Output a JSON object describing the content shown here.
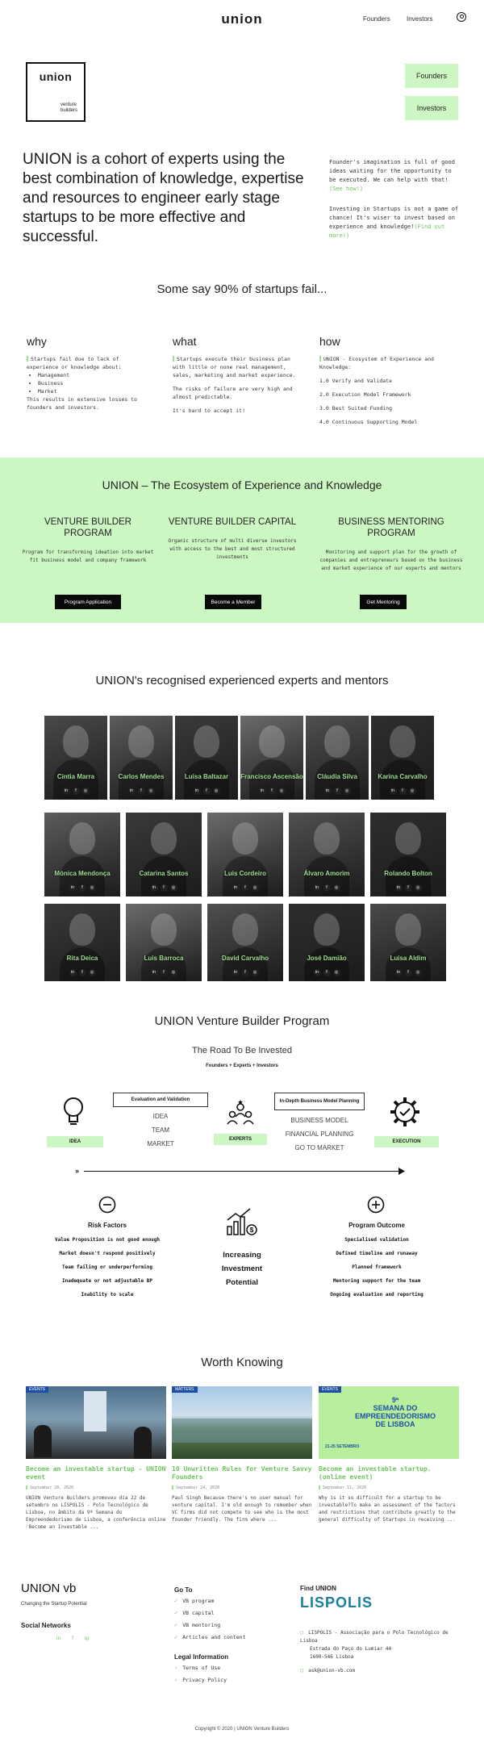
{
  "header": {
    "logo": "union",
    "nav": [
      "Founders",
      "Investors"
    ]
  },
  "brand": {
    "title": "union",
    "subtitle_line1": "venture",
    "subtitle_line2": "builders"
  },
  "side_buttons": [
    "Founders",
    "Investors"
  ],
  "hero": {
    "headline": "UNION is a cohort of experts using the best combination of knowledge, expertise and resources to engineer early stage startups to be more effective and successful.",
    "founders_text": "Founder's imagination is full of good ideas waiting for the opportunity to be executed. We can help with that!",
    "founders_link": "(See how!)",
    "investors_text": "Investing in Startups is not a game of chance! It's wiser to invest based on experience and knowledge!",
    "investors_link": "(Find out more!)"
  },
  "why_section": {
    "title": "Some say 90% of startups fail...",
    "why": {
      "heading": "why",
      "intro": "Startups fail due to lack of experience or knowledge about:",
      "items": [
        "Management",
        "Business",
        "Market"
      ],
      "outro": "This results in extensive losses to founders and investors."
    },
    "what": {
      "heading": "what",
      "p1": "Startups execute their business plan with little or none real management, sales, marketing and market experience.",
      "p2": "The risks of failure are very high and almost predictable.",
      "p3": "It's hard to accept it!"
    },
    "how": {
      "heading": "how",
      "items": [
        "UNION - Ecosystem of Experience and Knowledge:",
        "1.0 Verify and Validate",
        "2.0 Execution Model Framework",
        "3.0 Best Suited Funding",
        "4.0 Continuous Supporting Model"
      ]
    }
  },
  "ecosystem": {
    "title": "UNION – The Ecosystem of Experience and Knowledge",
    "columns": [
      {
        "title": "VENTURE BUILDER PROGRAM",
        "text": "Program for transforming ideation into market fit business model and company framework",
        "button": "Program Application"
      },
      {
        "title": "VENTURE BUILDER CAPITAL",
        "text": "Organic structure of multi diverse investors with access to the best and most structured investments",
        "button": "Become a Member"
      },
      {
        "title": "BUSINESS MENTORING PROGRAM",
        "text": "Monitoring and support plan for the growth of companies and entrepreneurs based on the business and market experience of our experts and mentors",
        "button": "Get Mentoring"
      }
    ]
  },
  "experts": {
    "title": "UNION's recognised experienced experts and mentors",
    "row1": [
      "Cintia Marra",
      "Carlos Mendes",
      "Luisa Baltazar",
      "Francisco Ascensão",
      "Cláudia Silva",
      "Karina Carvalho"
    ],
    "row2": [
      "Mónica Mendonça",
      "Catarina Santos",
      "Luis Cordeiro",
      "Álvaro Amorim",
      "Rolando Bolton"
    ],
    "row3": [
      "Rita Deica",
      "Luis Barroca",
      "David Carvalho",
      "José Damião",
      "Luisa Aldim"
    ]
  },
  "program": {
    "title": "UNION Venture Builder Program",
    "road": "The Road To Be Invested",
    "formula": "Founders + Experts + Investors",
    "box1": "Evaluation and Validation",
    "list1": [
      "IDEA",
      "TEAM",
      "MARKET"
    ],
    "box2": "In-Depth Business Model Planning",
    "list2": [
      "BUSINESS MODEL",
      "FINANCIAL PLANNING",
      "GO TO MARKET"
    ],
    "stage_labels": [
      "IDEA",
      "EXPERTS",
      "EXECUTION"
    ],
    "arrow_start": "»",
    "risk_title": "Risk Factors",
    "risks": [
      "Value Proposition is not good enough",
      "Market doesn't respond positively",
      "Team failing or underperforming",
      "Inadequate or not adjustable BP",
      "Inability to scale"
    ],
    "center_text": [
      "Increasing",
      "Investment",
      "Potential"
    ],
    "outcome_title": "Program Outcome",
    "outcomes": [
      "Specialised validation",
      "Defined timeline and runaway",
      "Planned framework",
      "Mentoring support for the team",
      "Ongoing evaluation and reporting"
    ]
  },
  "news": {
    "title": "Worth Knowing",
    "cards": [
      {
        "tag": "EVENTS",
        "title": "Become an investable startup - UNION event",
        "date": "September 28, 2020",
        "excerpt": "UNION Venture Builders promoveu dia 22 de setembro no LISPOLIS - Polo Tecnológico de Lisboa, no âmbito da 9ª Semana do Empreendedorismo de Lisboa, a conferência online 'Become an Investable ..."
      },
      {
        "tag": "MATTERS",
        "title": "10 Unwritten Rules for Venture Savvy Founders",
        "date": "September 24, 2020",
        "excerpt": "Paul Singh Because there's no user manual for venture capital. I'm old enough to remember when VC firms did not compete to see who is the most founder friendly. The firm where ..."
      },
      {
        "tag": "EVENTS",
        "title": "Become an investable startup. (online event)",
        "date": "September 11, 2020",
        "excerpt": "Why is it so difficult for a startup to be investable?To make an assessment of the factors and restrictions that contribute greatly to the general difficulty of Startups in receiving ...",
        "poster_line1": "9ª",
        "poster_line2": "SEMANA DO",
        "poster_line3": "EMPREENDEDORISMO",
        "poster_line4": "DE LISBOA",
        "poster_date": "21-25 SETEMBRO"
      }
    ]
  },
  "footer": {
    "brand": "UNION vb",
    "tagline": "Changing the Startup Potential",
    "social_title": "Social Networks",
    "social": [
      "in",
      "f",
      "ig"
    ],
    "goto_title": "Go To",
    "goto": [
      "VB program",
      "VB capital",
      "VB mentoring",
      "Articles and content"
    ],
    "legal_title": "Legal Information",
    "legal": [
      "Terms of Use",
      "Privacy Policy"
    ],
    "find_title": "Find UNION",
    "find_logo": "LISPOLIS",
    "address": "LISPOLIS - Associação para o Polo Tecnológico de Lisboa",
    "street": "Estrada do Paço do Lumiar 44",
    "city": "1600-546 Lisboa",
    "email": "ask@union-vb.com",
    "copyright": "Copyright © 2020 | UNION Venture Builders"
  },
  "colors": {
    "accent_green": "#ccf7c2",
    "link_green": "#6cc45b",
    "dark": "#0a0a0a",
    "tag_blue": "#1f4fa0"
  }
}
